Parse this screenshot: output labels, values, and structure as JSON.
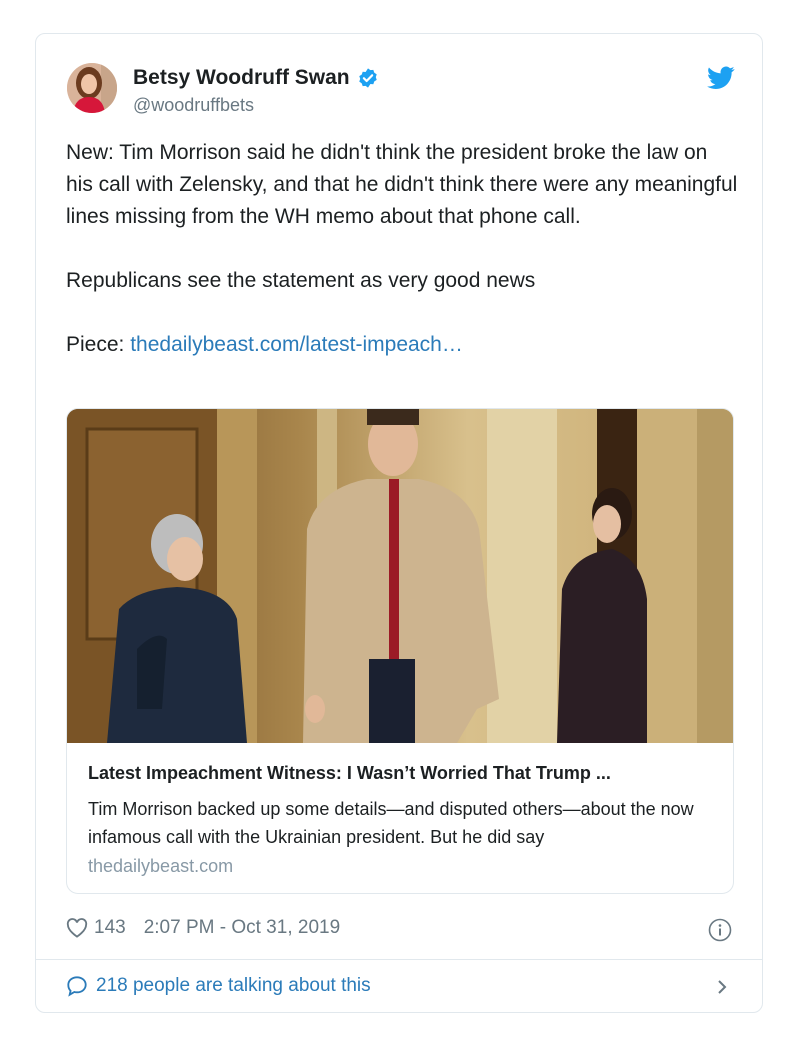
{
  "tweet": {
    "author_name": "Betsy Woodruff Swan",
    "handle": "@woodruffbets",
    "paragraphs": [
      "New: Tim Morrison said he didn't think the president broke the law on his call with Zelensky, and that he didn't think there were any meaningful lines missing from the WH memo about that phone call.",
      "Republicans see the statement as very good news"
    ],
    "piece_prefix": "Piece: ",
    "piece_link": "thedailybeast.com/latest-impeach…"
  },
  "card": {
    "title": "Latest Impeachment Witness: I Wasn’t Worried That Trump ...",
    "description": "Tim Morrison backed up some details—and disputed others—about the now infamous call with the Ukrainian president. But he did say",
    "domain": "thedailybeast.com"
  },
  "meta": {
    "likes": "143",
    "timestamp": "2:07 PM - Oct 31, 2019"
  },
  "footer": {
    "talking": "218 people are talking about this"
  },
  "colors": {
    "link": "#2b7bb9",
    "verified": "#1da1f2",
    "twitter_bird": "#1da1f2",
    "muted": "#697882",
    "border": "#e1e8ed"
  },
  "icons": [
    "verified-badge-icon",
    "twitter-bird-icon",
    "heart-icon",
    "info-icon",
    "speech-bubble-icon",
    "chevron-right-icon"
  ]
}
